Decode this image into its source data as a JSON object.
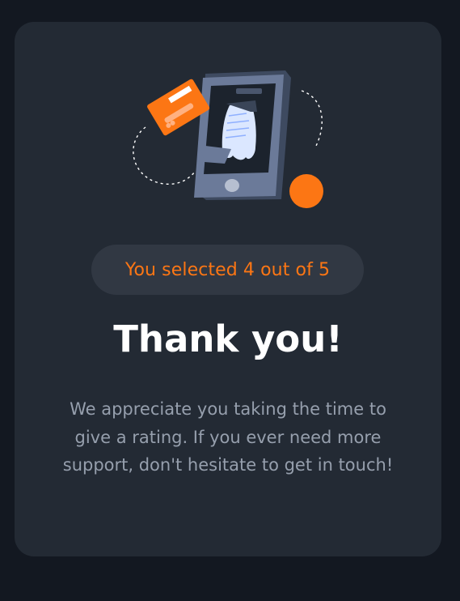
{
  "rating": {
    "selected": 4,
    "max": 5,
    "selection_text": "You selected 4 out of 5"
  },
  "thank_you": {
    "title": "Thank you!",
    "message": "We appreciate you taking the time to give a rating. If you ever need more support, don't hesitate to get in touch!"
  },
  "colors": {
    "page_background": "#131821",
    "card_background": "#232a34",
    "badge_background": "#313843",
    "accent_orange": "#fc7614",
    "title_white": "#ffffff",
    "body_grey": "#969fad"
  },
  "illustration": {
    "icon": "payment-receipt-illustration"
  }
}
